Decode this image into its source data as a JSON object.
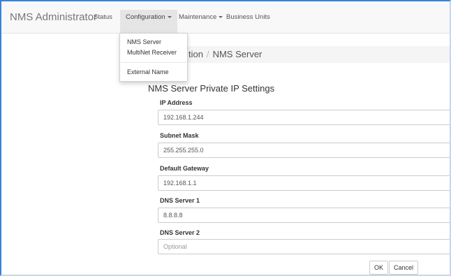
{
  "navbar": {
    "brand": "NMS Administrator",
    "items": [
      {
        "label": "Status"
      },
      {
        "label": "Configuration"
      },
      {
        "label": "Maintenance"
      },
      {
        "label": "Business Units"
      }
    ]
  },
  "dropdown": {
    "items": [
      {
        "label": "NMS Server"
      },
      {
        "label": "MultiNet Receiver"
      },
      {
        "label": "External Name"
      }
    ]
  },
  "breadcrumb": {
    "visible_fragment": "tion",
    "separator": "/",
    "current": "NMS Server"
  },
  "form": {
    "title": "NMS Server Private IP Settings",
    "fields": [
      {
        "label": "IP Address",
        "value": "192.168.1.244",
        "placeholder": ""
      },
      {
        "label": "Subnet Mask",
        "value": "255.255.255.0",
        "placeholder": ""
      },
      {
        "label": "Default Gateway",
        "value": "192.168.1.1",
        "placeholder": ""
      },
      {
        "label": "DNS Server 1",
        "value": "8.8.8.8",
        "placeholder": ""
      },
      {
        "label": "DNS Server 2",
        "value": "",
        "placeholder": "Optional"
      }
    ],
    "ok_label": "OK",
    "cancel_label": "Cancel"
  },
  "colors": {
    "frame": "#4a7ebb",
    "navbar_bg": "#f8f8f8",
    "active_tab_bg": "#e5e5e5"
  }
}
